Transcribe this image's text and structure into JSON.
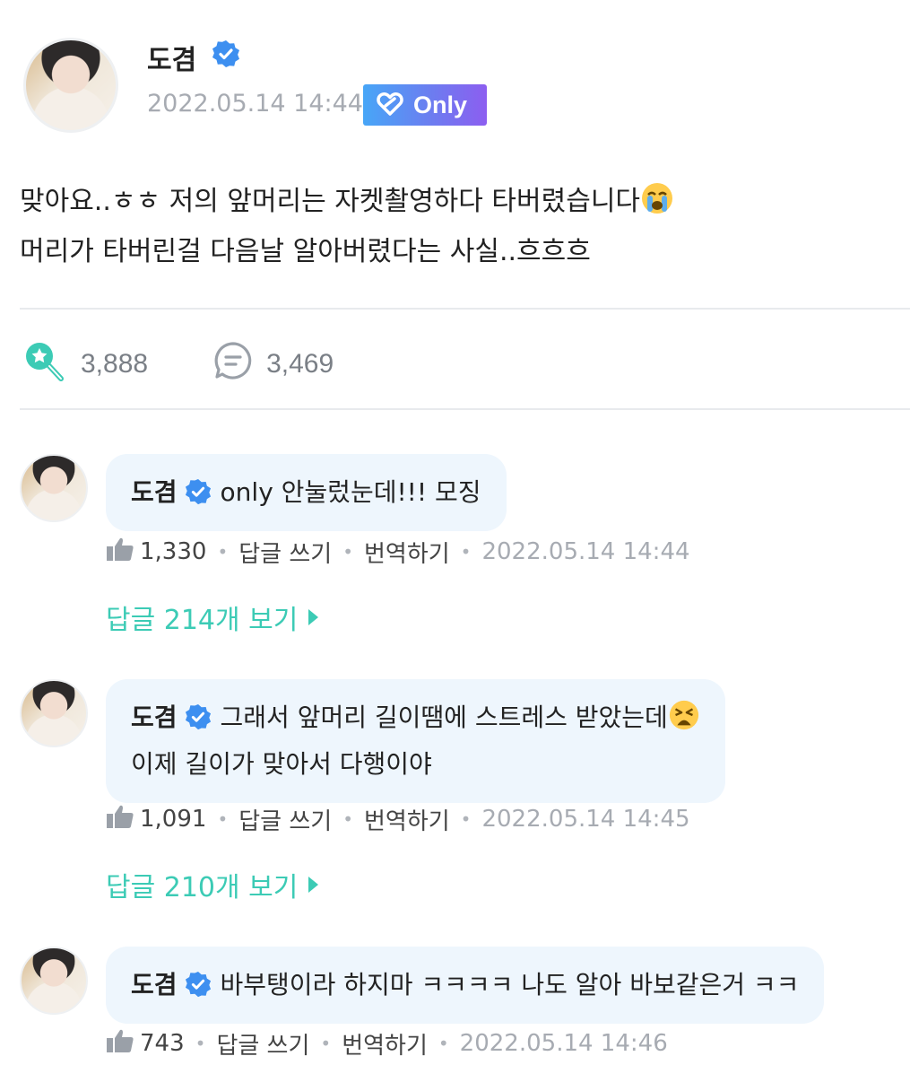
{
  "post": {
    "author": "도겸",
    "date": "2022.05.14 14:44",
    "badge": "Only",
    "line1": "맞아요..ㅎㅎ 저의 앞머리는 자켓촬영하다 타버렸습니다",
    "line2": "머리가 타버린걸 다음날 알아버렸다는 사실..흐흐흐",
    "line1_emoji": "loudly-crying-face",
    "likes": "3,888",
    "comments": "3,469"
  },
  "comments": [
    {
      "author": "도겸",
      "text_line1": "only 안눌렀눈데!!! 모징",
      "text_line2": "",
      "likes": "1,330",
      "reply_label": "답글 쓰기",
      "translate_label": "번역하기",
      "time": "2022.05.14 14:44",
      "view_replies": "답글 214개 보기"
    },
    {
      "author": "도겸",
      "text_line1": "그래서 앞머리 길이땜에 스트레스 받았는데",
      "text_line2": "이제 길이가 맞아서 다행이야",
      "line1_emoji": "tired-face",
      "likes": "1,091",
      "reply_label": "답글 쓰기",
      "translate_label": "번역하기",
      "time": "2022.05.14 14:45",
      "view_replies": "답글 210개 보기"
    },
    {
      "author": "도겸",
      "text_line1": "바부탱이라 하지마 ㅋㅋㅋㅋ 나도 알아 바보같은거 ㅋㅋ",
      "text_line2": "",
      "likes": "743",
      "reply_label": "답글 쓰기",
      "translate_label": "번역하기",
      "time": "2022.05.14 14:46"
    }
  ],
  "colors": {
    "accent": "#3ccbb5",
    "verified": "#3d8ff0",
    "bubble": "#eef6fd",
    "muted": "#a7abb2"
  }
}
